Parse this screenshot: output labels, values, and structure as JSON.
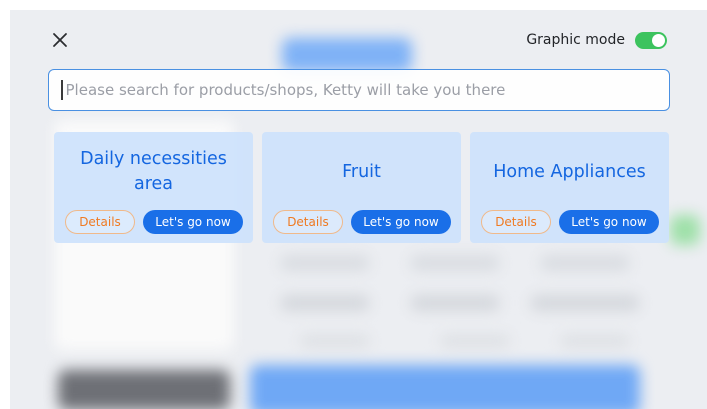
{
  "header": {
    "close_icon": "close-icon",
    "mode_label": "Graphic mode",
    "mode_enabled": true
  },
  "search": {
    "value": "",
    "placeholder": "Please search for products/shops, Ketty will take you there"
  },
  "cards": [
    {
      "title": "Daily necessities area",
      "details_label": "Details",
      "go_label": "Let's go now"
    },
    {
      "title": "Fruit",
      "details_label": "Details",
      "go_label": "Let's go now"
    },
    {
      "title": "Home Appliances",
      "details_label": "Details",
      "go_label": "Let's go now"
    }
  ],
  "colors": {
    "accent": "#1a6fe8",
    "title_blue": "#1466e0",
    "details_orange": "#ef7a22",
    "toggle_green": "#3cc35e",
    "card_bg": "#cde2fc"
  }
}
